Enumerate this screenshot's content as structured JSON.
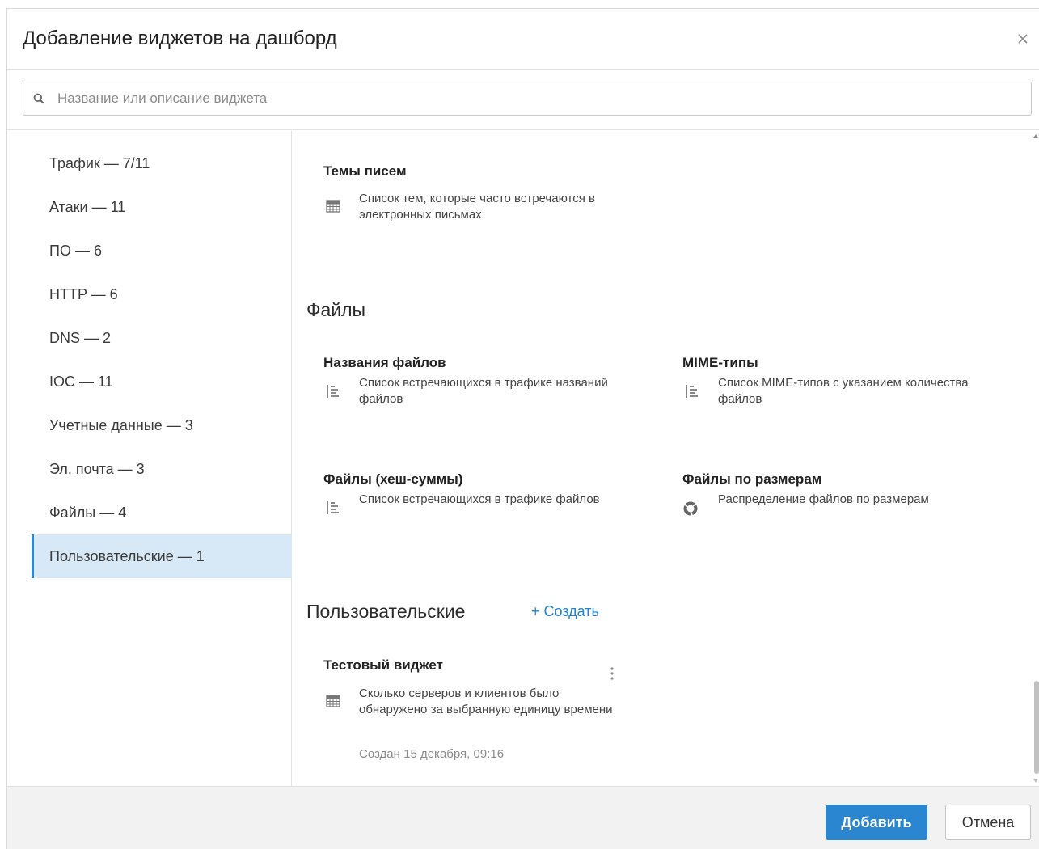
{
  "dialog": {
    "title": "Добавление виджетов на дашборд",
    "close_icon": "close-icon"
  },
  "search": {
    "placeholder": "Название или описание виджета",
    "value": "",
    "icon": "search-icon"
  },
  "sidebar": {
    "items": [
      {
        "label": "Трафик — 7/11",
        "active": false
      },
      {
        "label": "Атаки — 11",
        "active": false
      },
      {
        "label": "ПО — 6",
        "active": false
      },
      {
        "label": "HTTP — 6",
        "active": false
      },
      {
        "label": "DNS — 2",
        "active": false
      },
      {
        "label": "IOC — 11",
        "active": false
      },
      {
        "label": "Учетные данные — 3",
        "active": false
      },
      {
        "label": "Эл. почта — 3",
        "active": false
      },
      {
        "label": "Файлы — 4",
        "active": false
      },
      {
        "label": "Пользовательские — 1",
        "active": true
      }
    ],
    "active_color": "#d7e8f6",
    "active_border": "#2b8ad6"
  },
  "content": {
    "email_widgets": [
      {
        "title": "Темы писем",
        "description": "Список тем, которые часто встречаются в электронных письмах",
        "icon": "table-icon"
      }
    ],
    "files_section": {
      "title": "Файлы",
      "widgets": [
        {
          "title": "Названия файлов",
          "description": "Список встречающихся в трафике названий файлов",
          "icon": "list-icon"
        },
        {
          "title": "MIME-типы",
          "description": "Список MIME-типов с указанием количества файлов",
          "icon": "list-icon"
        },
        {
          "title": "Файлы (хеш-суммы)",
          "description": "Список встречающихся в трафике файлов",
          "icon": "list-icon"
        },
        {
          "title": "Файлы по размерам",
          "description": "Распределение файлов по размерам",
          "icon": "donut-chart-icon"
        }
      ]
    },
    "custom_section": {
      "title": "Пользовательские",
      "create_label": "+ Создать",
      "widgets": [
        {
          "title": "Тестовый виджет",
          "description": "Сколько серверов и клиентов было обнаружено за выбранную единицу времени",
          "icon": "table-icon",
          "created": "Создан 15 декабря, 09:16",
          "menu_icon": "kebab-menu-icon"
        }
      ]
    }
  },
  "footer": {
    "add_label": "Добавить",
    "cancel_label": "Отмена",
    "add_color": "#2b86d1"
  }
}
